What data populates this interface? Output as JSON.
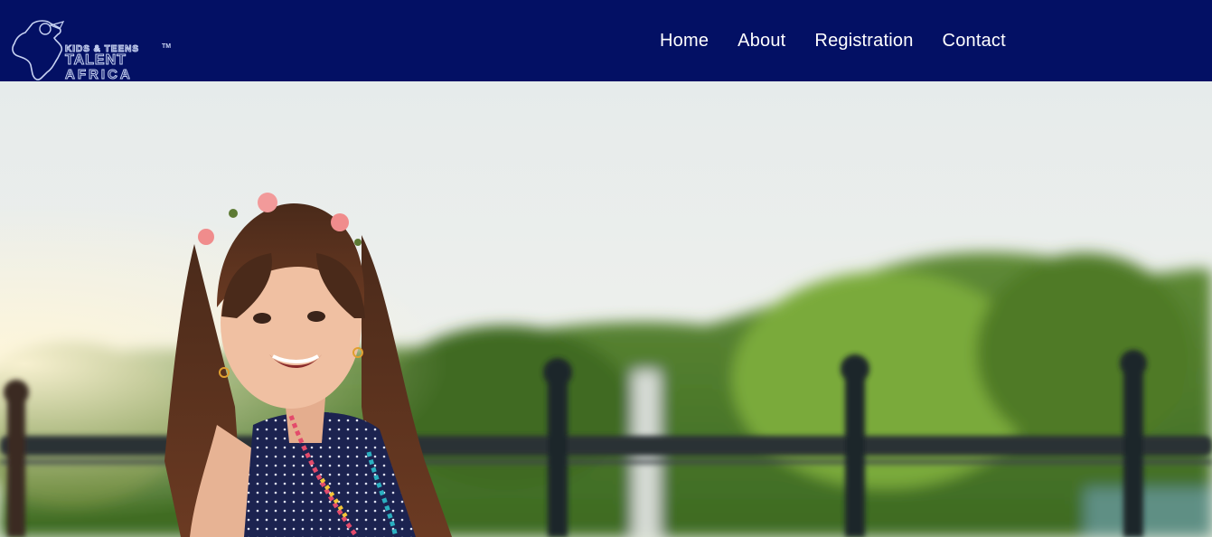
{
  "brand": {
    "logo_lines": [
      "KIDS & TEENS",
      "TALENT",
      "AFRICA"
    ],
    "trademark": "TM",
    "colors": {
      "nav_bg": "#031064",
      "logo_outline": "#c7d2f2"
    }
  },
  "nav": {
    "items": [
      {
        "label": "Home"
      },
      {
        "label": "About"
      },
      {
        "label": "Registration"
      },
      {
        "label": "Contact"
      }
    ]
  },
  "hero": {
    "image": "smiling-girl-with-flower-crown-by-railing"
  }
}
